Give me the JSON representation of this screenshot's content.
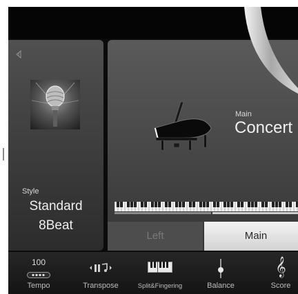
{
  "style_panel": {
    "category": "Style",
    "name": "Standard\n8Beat",
    "collapse_icon": "chevron-left-icon",
    "image_icon": "microphone-image"
  },
  "voice_panel": {
    "part_label": "Main",
    "voice_name": "Concert",
    "image_icon": "grand-piano-image",
    "tabs": [
      {
        "label": "Left",
        "active": false
      },
      {
        "label": "Main",
        "active": true
      }
    ]
  },
  "toolbar": {
    "items": [
      {
        "label": "Tempo",
        "value": "100",
        "icon": "tempo-dots-icon"
      },
      {
        "label": "Transpose",
        "icon": "transpose-icon"
      },
      {
        "label": "Split&Fingering",
        "icon": "split-keyboard-icon"
      },
      {
        "label": "Balance",
        "icon": "balance-slider-icon"
      },
      {
        "label": "Score",
        "icon": "treble-clef-icon"
      }
    ]
  },
  "colors": {
    "background": "#0b0b0b",
    "panel": "#4a4a4a",
    "active_tab": "#e6e6e6",
    "text": "#eeeeee"
  }
}
